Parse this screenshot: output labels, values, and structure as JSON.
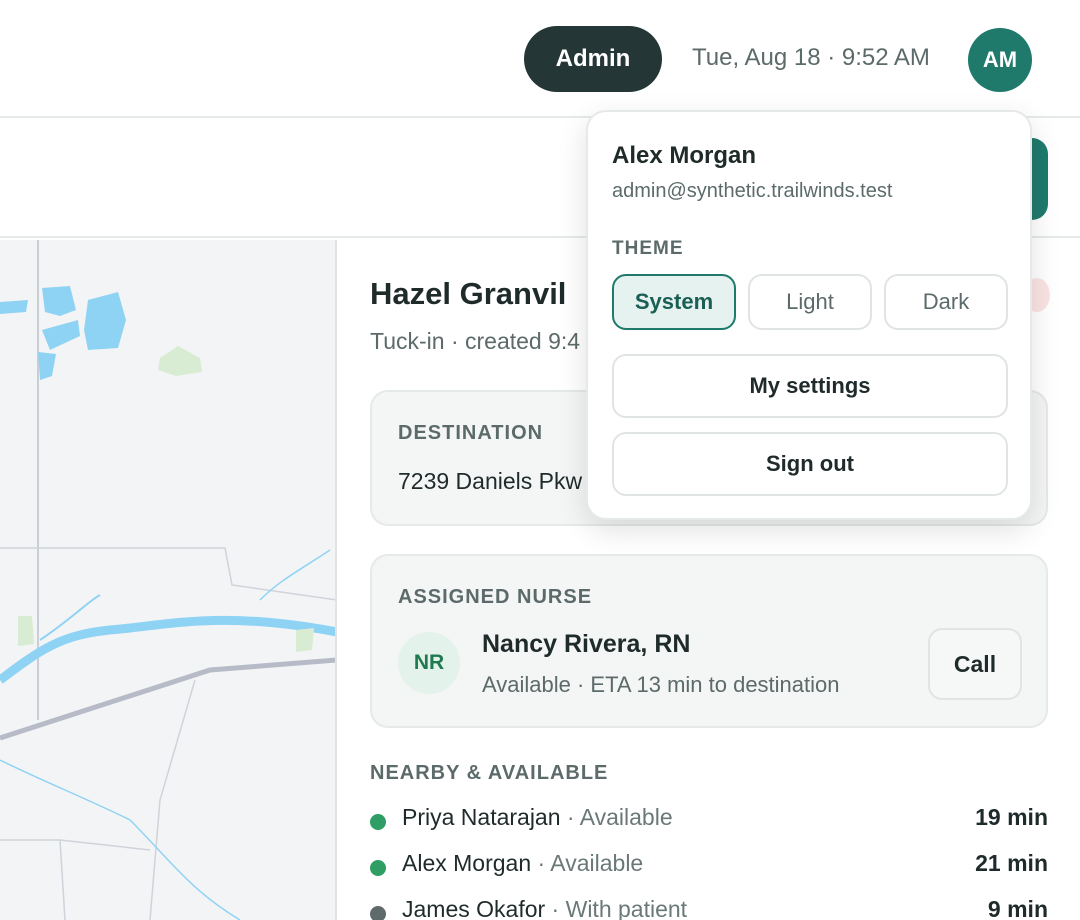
{
  "header": {
    "role_label": "Admin",
    "datetime": "Tue, Aug 18 · 9:52 AM",
    "avatar_initials": "AM"
  },
  "patient": {
    "name": "Hazel Granvil",
    "subtitle": "Tuck-in · created 9:4"
  },
  "destination": {
    "label": "DESTINATION",
    "address": "7239 Daniels Pkw"
  },
  "assigned_nurse": {
    "label": "ASSIGNED NURSE",
    "initials": "NR",
    "name": "Nancy Rivera, RN",
    "status": "Available · ETA 13 min to destination",
    "call_label": "Call"
  },
  "nearby": {
    "title": "NEARBY & AVAILABLE",
    "items": [
      {
        "name": "Priya Natarajan",
        "sep": " · ",
        "status": "Available",
        "eta": "19 min",
        "dot_color": "#2f9e64"
      },
      {
        "name": "Alex Morgan",
        "sep": " · ",
        "status": "Available",
        "eta": "21 min",
        "dot_color": "#2f9e64"
      },
      {
        "name": "James Okafor",
        "sep": " · ",
        "status": "With patient",
        "eta": "9 min",
        "dot_color": "#5f6b6b"
      }
    ]
  },
  "account_menu": {
    "name": "Alex Morgan",
    "email": "admin@synthetic.trailwinds.test",
    "theme_label": "THEME",
    "theme_options": [
      "System",
      "Light",
      "Dark"
    ],
    "selected_theme": "System",
    "settings_label": "My settings",
    "signout_label": "Sign out"
  },
  "colors": {
    "accent": "#1f7a6c",
    "role_pill": "#253636",
    "available": "#2f9e64",
    "busy": "#5f6b6b"
  }
}
